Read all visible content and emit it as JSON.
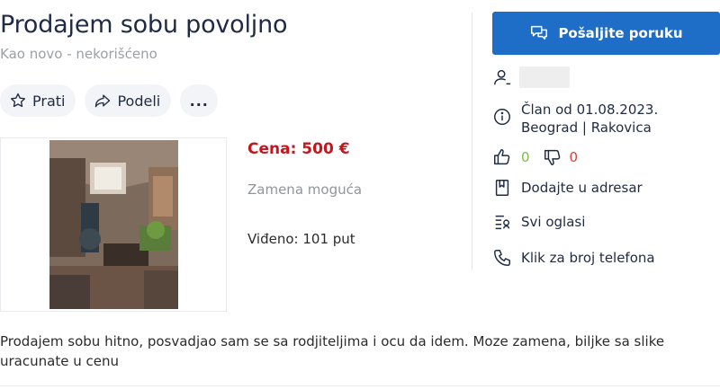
{
  "listing": {
    "title": "Prodajem sobu povoljno",
    "condition": "Kao novo - nekorišćeno",
    "price": "Cena: 500 €",
    "exchange": "Zamena moguća",
    "views": "Viđeno: 101 put",
    "description": "Prodajem sobu hitno, posvadjao sam se sa rodjiteljima i ocu da idem. Moze zamena, biljke sa slike uracunate u cenu"
  },
  "actions": {
    "follow_label": "Prati",
    "share_label": "Podeli",
    "more_label": "..."
  },
  "sidebar": {
    "send_message_label": "Pošaljite poruku",
    "member_since": "Član od 01.08.2023.",
    "location": "Beograd | Rakovica",
    "positive_count": "0",
    "negative_count": "0",
    "add_to_addressbook": "Dodajte u adresar",
    "all_ads": "Svi oglasi",
    "phone_click": "Klik za broj telefona"
  },
  "colors": {
    "accent": "#1e6ec8",
    "price": "#c4161c",
    "positive": "#7bbf4a",
    "negative": "#d9433a"
  }
}
